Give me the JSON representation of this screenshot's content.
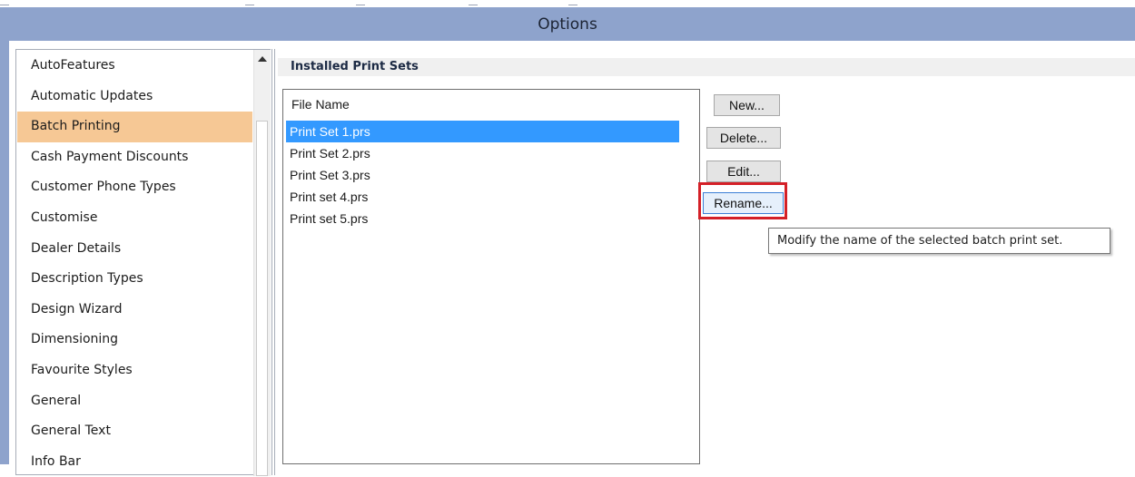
{
  "window": {
    "title": "Options"
  },
  "sidebar": {
    "selected_index": 2,
    "items": [
      {
        "label": "AutoFeatures"
      },
      {
        "label": "Automatic Updates"
      },
      {
        "label": "Batch Printing"
      },
      {
        "label": "Cash Payment Discounts"
      },
      {
        "label": "Customer Phone Types"
      },
      {
        "label": "Customise"
      },
      {
        "label": "Dealer Details"
      },
      {
        "label": "Description Types"
      },
      {
        "label": "Design Wizard"
      },
      {
        "label": "Dimensioning"
      },
      {
        "label": "Favourite Styles"
      },
      {
        "label": "General"
      },
      {
        "label": "General Text"
      },
      {
        "label": "Info Bar"
      }
    ]
  },
  "main": {
    "section_title": "Installed Print Sets",
    "file_list": {
      "column_header": "File Name",
      "selected_index": 0,
      "rows": [
        {
          "name": "Print Set 1.prs"
        },
        {
          "name": "Print Set 2.prs"
        },
        {
          "name": "Print Set 3.prs"
        },
        {
          "name": "Print set 4.prs"
        },
        {
          "name": "Print set 5.prs"
        }
      ]
    },
    "buttons": {
      "new": "New...",
      "delete": "Delete...",
      "edit": "Edit...",
      "rename": "Rename..."
    },
    "tooltip": "Modify the name of the selected batch print set."
  },
  "colors": {
    "titlebar": "#8ea3cc",
    "sidebar_selected": "#f6c895",
    "list_selected": "#3399ff",
    "highlight": "#d42027"
  }
}
